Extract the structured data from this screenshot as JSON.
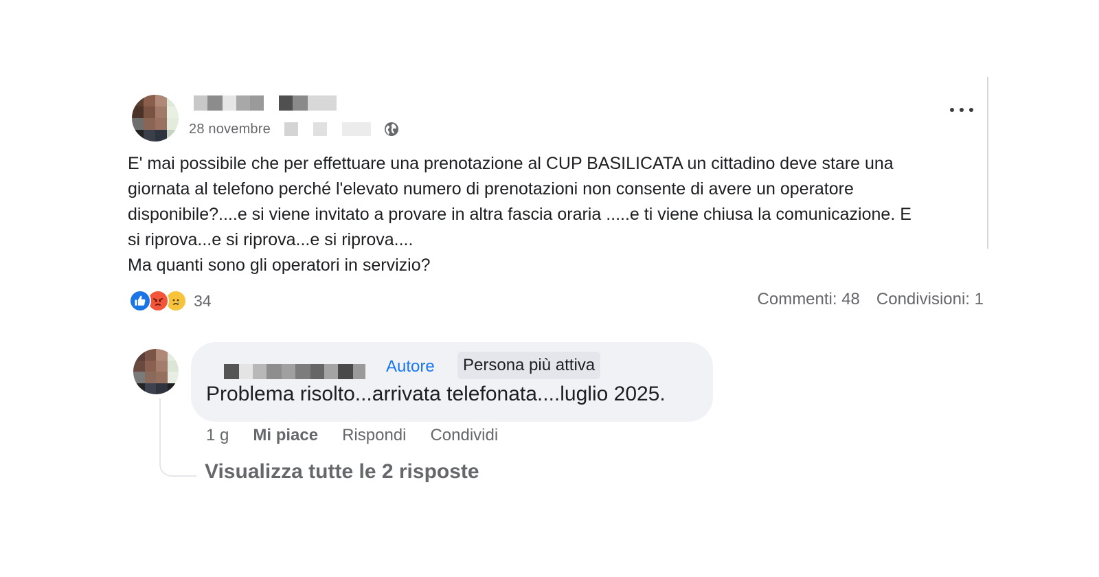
{
  "post": {
    "date": "28 novembre",
    "body_lines": [
      "E' mai possibile che per effettuare una prenotazione al CUP BASILICATA un cittadino deve stare una",
      "giornata al telefono perché l'elevato numero di prenotazioni non consente di avere un operatore",
      "disponibile?....e si viene invitato a provare in altra fascia oraria .....e ti viene chiusa la comunicazione. E",
      "si riprova...e si riprova...e si riprova....",
      "Ma quanti sono gli operatori in servizio?"
    ],
    "privacy_icon": "globe-icon",
    "more_icon": "more-horizontal-icon"
  },
  "reactions": {
    "icons": [
      "like-icon",
      "angry-icon",
      "sad-icon"
    ],
    "count": "34",
    "colors": {
      "like": "#1b74e4",
      "angry": "#f2553a",
      "sad": "#f7c33b"
    }
  },
  "stats": {
    "comments": "Commenti: 48",
    "shares": "Condivisioni: 1"
  },
  "comment": {
    "badge_author": "Autore",
    "badge_active": "Persona più attiva",
    "text": "Problema risolto...arrivata telefonata....luglio 2025.",
    "time": "1 g",
    "like": "Mi piace",
    "reply": "Rispondi",
    "share": "Condividi",
    "view_replies": "Visualizza tutte le 2 risposte"
  },
  "colors": {
    "link_blue": "#1877f2",
    "secondary_text": "#65676b",
    "bubble_bg": "#f0f2f5"
  }
}
